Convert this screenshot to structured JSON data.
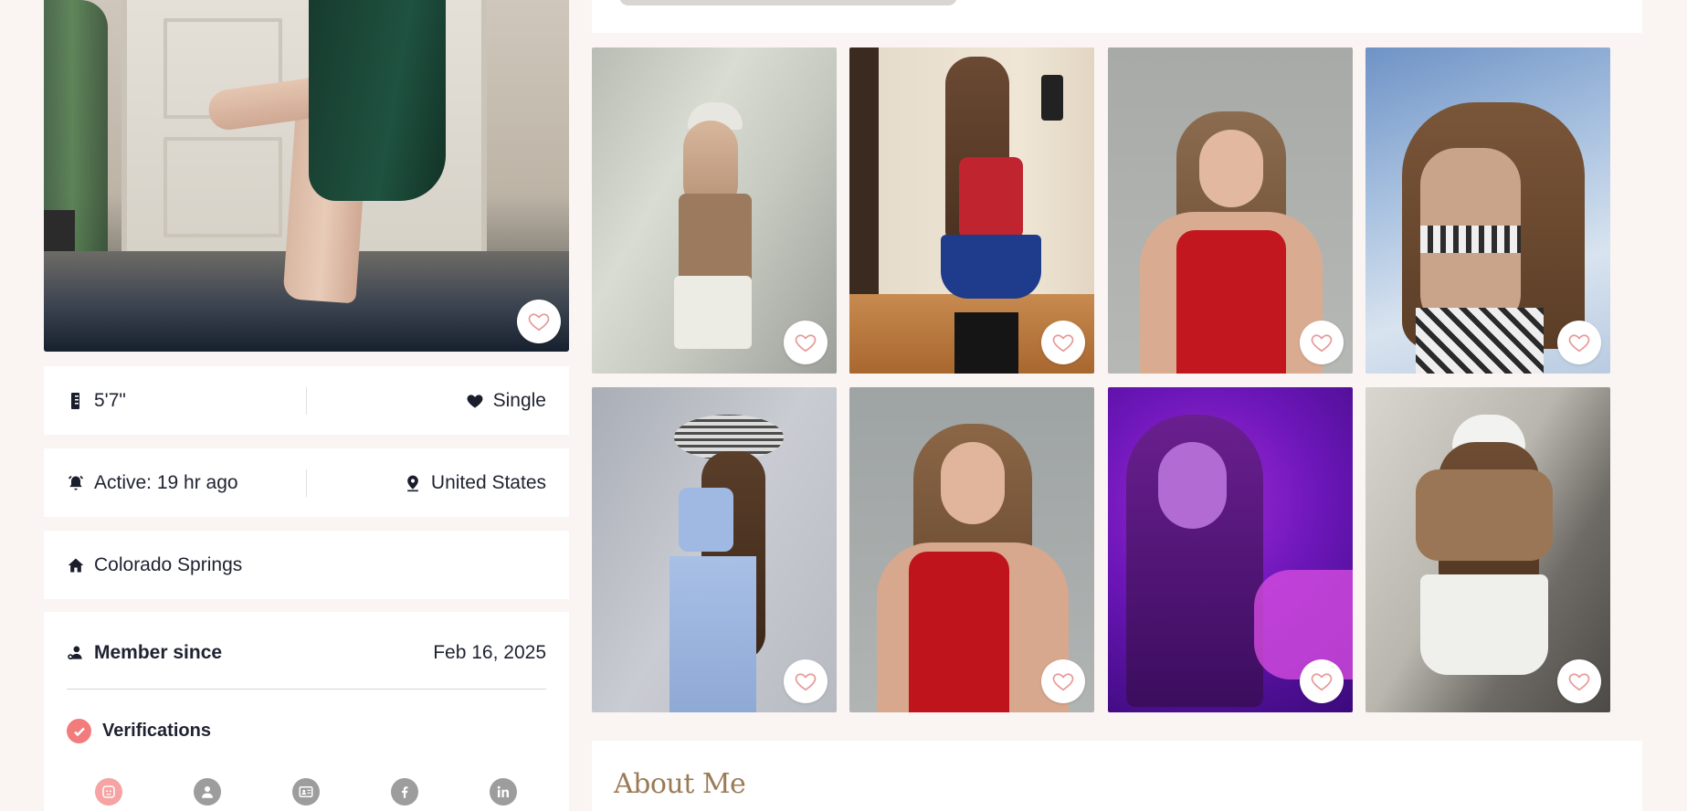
{
  "profile": {
    "height": "5'7\"",
    "relationship_status": "Single",
    "activity": "Active: 19 hr ago",
    "country": "United States",
    "city": "Colorado Springs",
    "member_since_label": "Member since",
    "member_since_date": "Feb 16, 2025",
    "verifications_label": "Verifications"
  },
  "verification_icons": [
    "face-verification-icon",
    "profile-verification-icon",
    "id-card-verification-icon",
    "facebook-verification-icon",
    "linkedin-verification-icon"
  ],
  "gallery": [
    {
      "name": "gallery-photo-1",
      "desc": "white cap, tan top, white shorts"
    },
    {
      "name": "gallery-photo-2",
      "desc": "superhero costume mirror selfie"
    },
    {
      "name": "gallery-photo-3",
      "desc": "red halter top smiling"
    },
    {
      "name": "gallery-photo-4",
      "desc": "leopard swimsuit under sky"
    },
    {
      "name": "gallery-photo-5",
      "desc": "sun hat blue outfit"
    },
    {
      "name": "gallery-photo-6",
      "desc": "red top portrait"
    },
    {
      "name": "gallery-photo-7",
      "desc": "purple neon light"
    },
    {
      "name": "gallery-photo-8",
      "desc": "white cap from behind"
    }
  ],
  "about": {
    "title": "About Me"
  },
  "colors": {
    "page_bg": "#faf4f2",
    "card_bg": "#ffffff",
    "heart_stroke": "#e89a9a",
    "verified_accent": "#f27c7c",
    "about_title": "#9b7b56"
  }
}
